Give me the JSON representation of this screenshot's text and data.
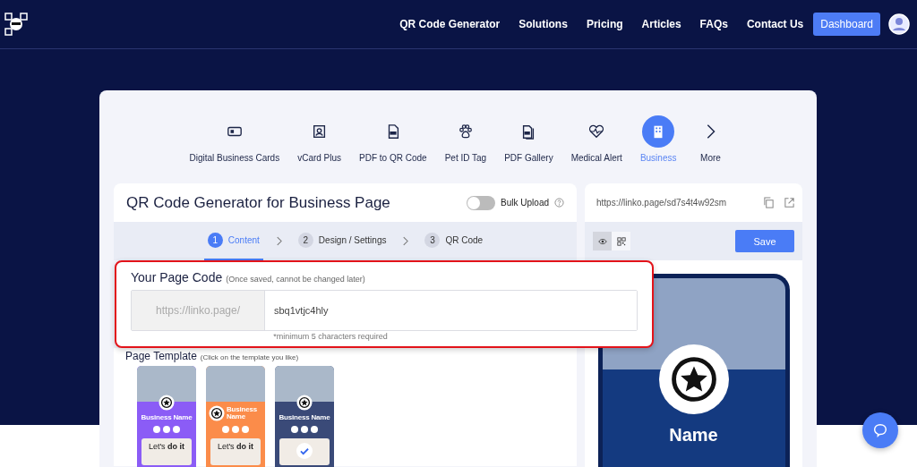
{
  "nav": {
    "links": [
      "QR Code Generator",
      "Solutions",
      "Pricing",
      "Articles",
      "FAQs",
      "Contact Us"
    ],
    "button": "Dashboard"
  },
  "categories": [
    {
      "label": "Digital Business Cards",
      "kind": "card",
      "selected": false
    },
    {
      "label": "vCard Plus",
      "kind": "vcard",
      "selected": false
    },
    {
      "label": "PDF to QR Code",
      "kind": "pdf",
      "selected": false
    },
    {
      "label": "Pet ID Tag",
      "kind": "pet",
      "selected": false
    },
    {
      "label": "PDF Gallery",
      "kind": "gallery",
      "selected": false
    },
    {
      "label": "Medical Alert",
      "kind": "medical",
      "selected": false
    },
    {
      "label": "Business",
      "kind": "business",
      "selected": true
    },
    {
      "label": "More",
      "kind": "more",
      "selected": false
    }
  ],
  "editor": {
    "title": "QR Code Generator for Business Page",
    "bulk_upload": {
      "label": "Bulk Upload",
      "on": false
    },
    "steps": [
      {
        "number": "1",
        "label": "Content",
        "selected": true
      },
      {
        "number": "2",
        "label": "Design / Settings",
        "selected": false
      },
      {
        "number": "3",
        "label": "QR Code",
        "selected": false
      }
    ]
  },
  "page_code": {
    "title": "Your Page Code",
    "note": "(Once saved, cannot be changed later)",
    "prefix": "https://linko.page/",
    "value": "sbq1vtjc4hly",
    "hint": "*minimum 5 characters required"
  },
  "page_template": {
    "title": "Page Template",
    "note": "(Click on the template you like)",
    "templates": [
      {
        "color": "#8b5cf6",
        "kind": "center",
        "name": "Business Name",
        "tagline": "Let's **do it**",
        "selected": false
      },
      {
        "color": "#fb8c4a",
        "kind": "left",
        "name": "Business Name",
        "tagline": "Let's **do it**",
        "selected": false
      },
      {
        "color": "#3a4a78",
        "kind": "center",
        "name": "Business Name",
        "selected": true
      }
    ]
  },
  "preview": {
    "url": "https://linko.page/sd7s4t4w92sm",
    "save": "Save",
    "views": [
      {
        "kind": "eye",
        "selected": true
      },
      {
        "kind": "qr",
        "selected": false
      }
    ],
    "name": "Name"
  }
}
